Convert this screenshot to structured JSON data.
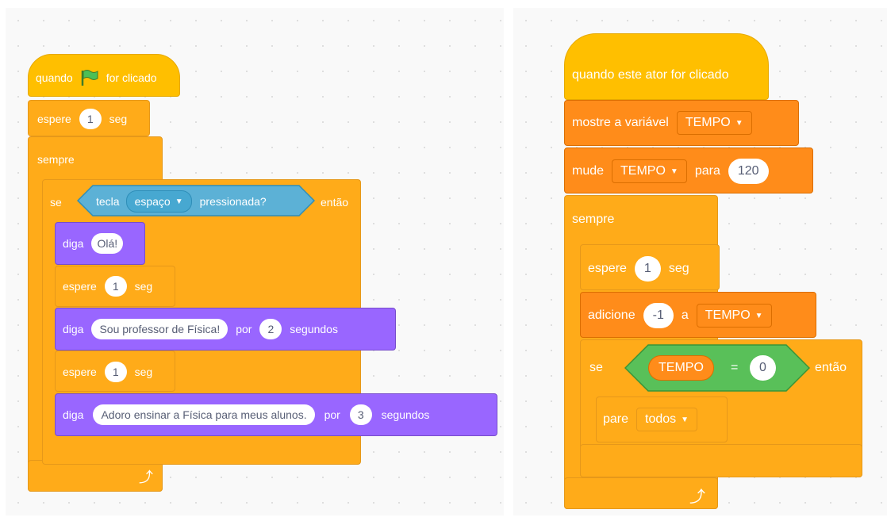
{
  "left_script": {
    "hat": {
      "when": "quando",
      "after": "for clicado",
      "flag": "green-flag-icon"
    },
    "wait1": {
      "label": "espere",
      "value": "1",
      "unit": "seg"
    },
    "forever": {
      "label": "sempre"
    },
    "if": {
      "label": "se",
      "then": "então",
      "condition": {
        "key_label": "tecla",
        "key_value": "espaço",
        "suffix": "pressionada?"
      }
    },
    "say1": {
      "label": "diga",
      "value": "Olá!"
    },
    "wait2": {
      "label": "espere",
      "value": "1",
      "unit": "seg"
    },
    "say2": {
      "label": "diga",
      "value": "Sou professor de Física!",
      "for": "por",
      "secs": "2",
      "unit": "segundos"
    },
    "wait3": {
      "label": "espere",
      "value": "1",
      "unit": "seg"
    },
    "say3": {
      "label": "diga",
      "value": "Adoro ensinar a Física para meus alunos.",
      "for": "por",
      "secs": "3",
      "unit": "segundos"
    }
  },
  "right_script": {
    "hat": {
      "label": "quando este ator for clicado"
    },
    "show_var": {
      "label": "mostre a variável",
      "var": "TEMPO"
    },
    "set_var": {
      "label": "mude",
      "var": "TEMPO",
      "to": "para",
      "value": "120"
    },
    "forever": {
      "label": "sempre"
    },
    "wait": {
      "label": "espere",
      "value": "1",
      "unit": "seg"
    },
    "change": {
      "label": "adicione",
      "value": "-1",
      "to": "a",
      "var": "TEMPO"
    },
    "if": {
      "label": "se",
      "then": "então",
      "condition": {
        "var": "TEMPO",
        "op": "=",
        "value": "0"
      }
    },
    "stop": {
      "label": "pare",
      "option": "todos"
    }
  },
  "colors": {
    "events": "#ffbf00",
    "control": "#ffab19",
    "variables": "#ff8c1a",
    "looks": "#9966ff",
    "sensing": "#5cb1d6",
    "operators": "#59c059"
  }
}
